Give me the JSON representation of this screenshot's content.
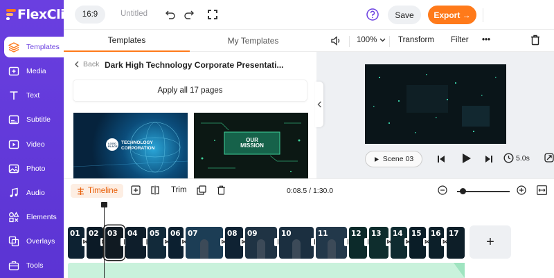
{
  "app": {
    "logo_text": "FlexClip"
  },
  "sidebar": {
    "items": [
      {
        "label": "Templates",
        "icon": "layers-icon",
        "active": true
      },
      {
        "label": "Media",
        "icon": "media-icon"
      },
      {
        "label": "Text",
        "icon": "text-icon"
      },
      {
        "label": "Subtitle",
        "icon": "subtitle-icon"
      },
      {
        "label": "Video",
        "icon": "video-icon"
      },
      {
        "label": "Photo",
        "icon": "photo-icon"
      },
      {
        "label": "Audio",
        "icon": "audio-icon"
      },
      {
        "label": "Elements",
        "icon": "elements-icon"
      },
      {
        "label": "Overlays",
        "icon": "overlays-icon"
      },
      {
        "label": "Tools",
        "icon": "tools-icon"
      }
    ]
  },
  "topbar": {
    "ratio": "16:9",
    "project_name": "Untitled",
    "save_label": "Save",
    "export_label": "Export →"
  },
  "templates_panel": {
    "tabs": [
      "Templates",
      "My Templates"
    ],
    "back_label": "Back",
    "title": "Dark High Technology Corporate Presentati...",
    "apply_label": "Apply all 17 pages",
    "thumb1_text": {
      "badge": "LOGO PLACE",
      "line1": "TECHNOLOGY",
      "line2": "CORPORATION"
    },
    "thumb2_text": {
      "line1": "OUR",
      "line2": "MISSION"
    }
  },
  "editor": {
    "zoom": "100%",
    "transform_label": "Transform",
    "filter_label": "Filter",
    "more_label": "•••",
    "scene_label": "Scene",
    "scene_number": "03",
    "duration": "5.0s"
  },
  "timeline": {
    "timeline_label": "Timeline",
    "trim_label": "Trim",
    "time": "0:08.5 / 1:30.0",
    "zoom_level": 0.1,
    "clips": [
      "01",
      "02",
      "03",
      "04",
      "05",
      "06",
      "07",
      "08",
      "09",
      "10",
      "11",
      "12",
      "13",
      "14",
      "15",
      "16",
      "17"
    ],
    "add_label": "+"
  }
}
